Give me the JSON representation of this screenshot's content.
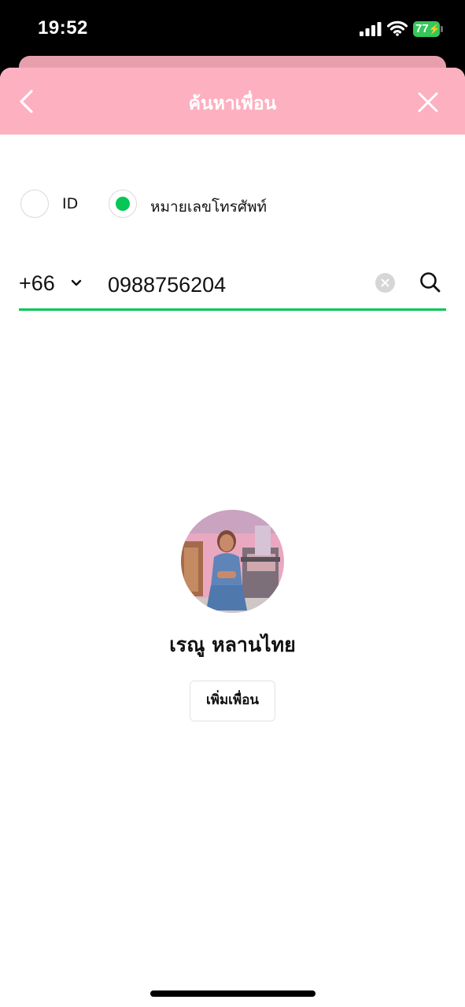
{
  "status_bar": {
    "time": "19:52",
    "battery_level": "77",
    "battery_charging": true,
    "icons": [
      "signal-icon",
      "wifi-icon",
      "battery-icon"
    ]
  },
  "header": {
    "title": "ค้นหาเพื่อน",
    "back_icon": "chevron-left-icon",
    "close_icon": "close-icon",
    "color": "#fdb0c0"
  },
  "search_type": {
    "options": [
      {
        "label": "ID",
        "selected": false
      },
      {
        "label": "หมายเลขโทรศัพท์",
        "selected": true
      }
    ],
    "selected_color": "#06c755"
  },
  "phone_search": {
    "country_code": "+66",
    "phone_number": "0988756204",
    "clear_icon": "clear-icon",
    "search_icon": "search-icon",
    "underline_color": "#06c755"
  },
  "result": {
    "name": "เรณู หลานไทย",
    "add_button_label": "เพิ่มเพื่อน"
  }
}
